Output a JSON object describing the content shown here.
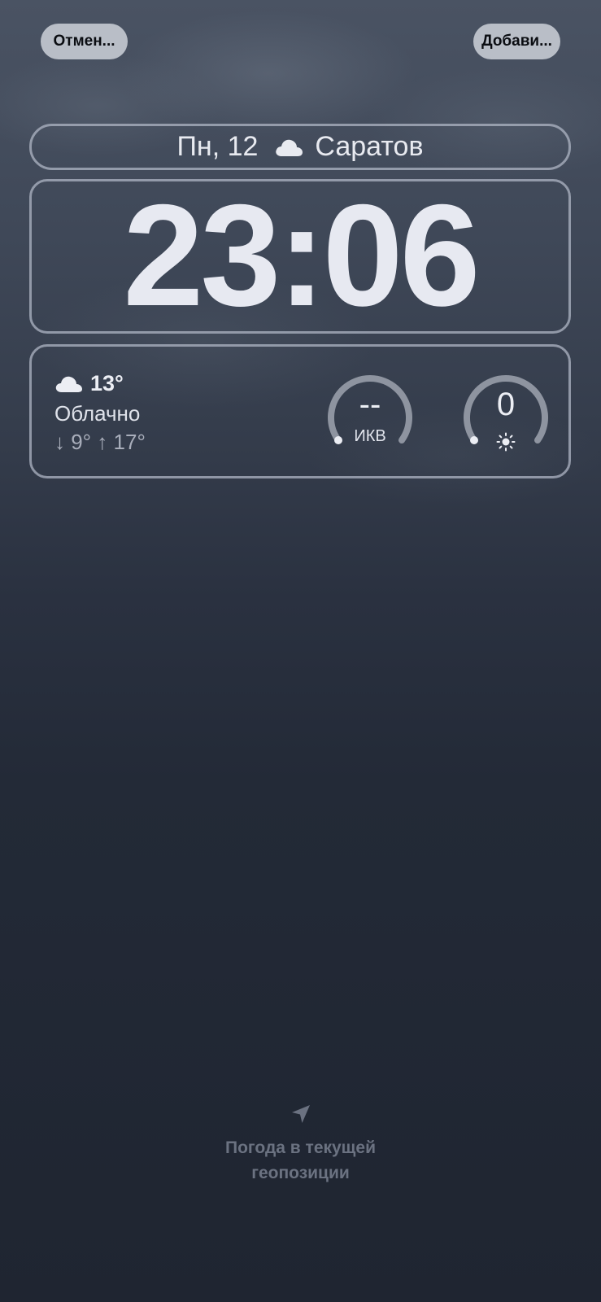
{
  "buttons": {
    "cancel": "Отмен...",
    "add": "Добави..."
  },
  "date_bar": {
    "date": "Пн, 12",
    "city": "Саратов",
    "icon": "cloud-icon"
  },
  "clock": {
    "time": "23:06"
  },
  "weather": {
    "temperature": "13°",
    "condition": "Облачно",
    "range": "↓ 9° ↑ 17°",
    "icon": "cloud-icon"
  },
  "aqi_gauge": {
    "value": "--",
    "label": "ИКВ"
  },
  "uv_gauge": {
    "value": "0",
    "icon": "sun-icon"
  },
  "location": {
    "line1": "Погода в текущей",
    "line2": "геопозиции",
    "icon": "location-arrow-icon"
  },
  "colors": {
    "background": "#1f2531",
    "frame": "#afb6c4",
    "pill": "#b9bec7",
    "muted_text": "#6b7281"
  }
}
